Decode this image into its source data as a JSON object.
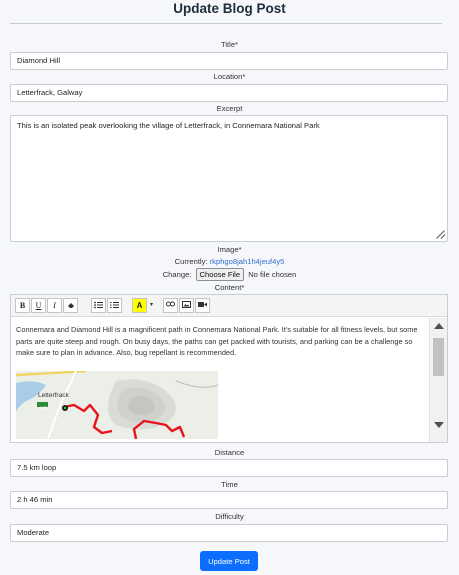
{
  "page": {
    "heading": "Update Blog Post",
    "submit_label": "Update Post"
  },
  "form": {
    "title": {
      "label": "Title*",
      "value": "Diamond Hill"
    },
    "location": {
      "label": "Location*",
      "value": "Letterfrack, Galway"
    },
    "excerpt": {
      "label": "Excerpt",
      "value": "This is an isolated peak overlooking the village of Letterfrack, in Connemara National Park"
    },
    "image": {
      "label": "Image*",
      "currently_label": "Currently:",
      "current_file": "rkphgo8jah1h4jeuf4y5",
      "change_label": "Change:",
      "choose_button": "Choose File",
      "no_file_text": "No file chosen"
    },
    "content": {
      "label": "Content*",
      "text": "Connemara and Diamond Hill is a magnificent path in Connemara National Park. It's suitable for all fitness levels, but some parts are quite steep and rough. On busy days, the paths can get packed with tourists, and parking can be a challenge so make sure to plan in advance. Also, bug repellant is recommended.",
      "map_label": "Letterfrack",
      "map_road_badge": "N59",
      "toolbar_icons": [
        "bold-icon",
        "underline-icon",
        "italic-icon",
        "eraser-icon",
        "unordered-list-icon",
        "ordered-list-icon",
        "text-color-icon",
        "link-icon",
        "picture-icon",
        "video-icon"
      ]
    },
    "distance": {
      "label": "Distance",
      "value": "7.5 km loop"
    },
    "time": {
      "label": "Time",
      "value": "2 h 46 min"
    },
    "difficulty": {
      "label": "Difficulty",
      "value": "Moderate"
    }
  },
  "colors": {
    "accent": "#0d6efd",
    "link": "#2f6fd1",
    "trail": "#e8141c"
  }
}
